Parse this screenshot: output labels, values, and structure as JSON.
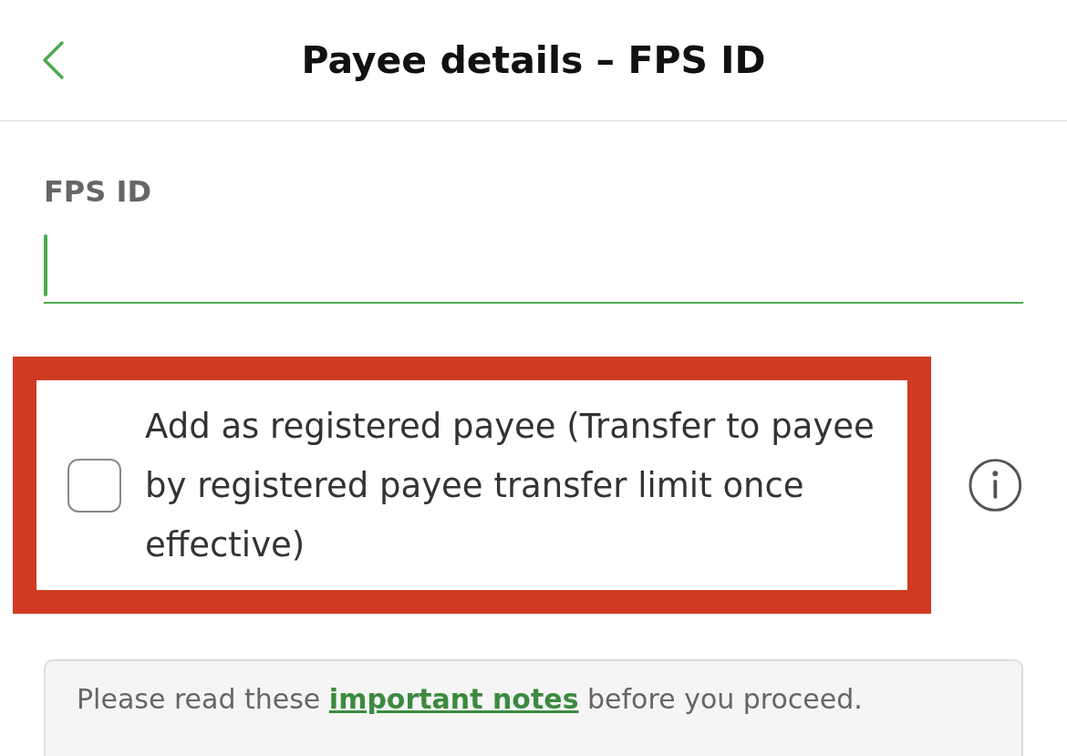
{
  "header": {
    "title": "Payee details – FPS ID"
  },
  "field": {
    "label": "FPS ID",
    "focused": true
  },
  "register_option": {
    "label": "Add as registered payee (Transfer to payee by registered payee transfer limit once effective)",
    "checked": false,
    "highlighted": true
  },
  "notes": {
    "before": "Please read these ",
    "link": "important notes",
    "after": " before you proceed."
  }
}
